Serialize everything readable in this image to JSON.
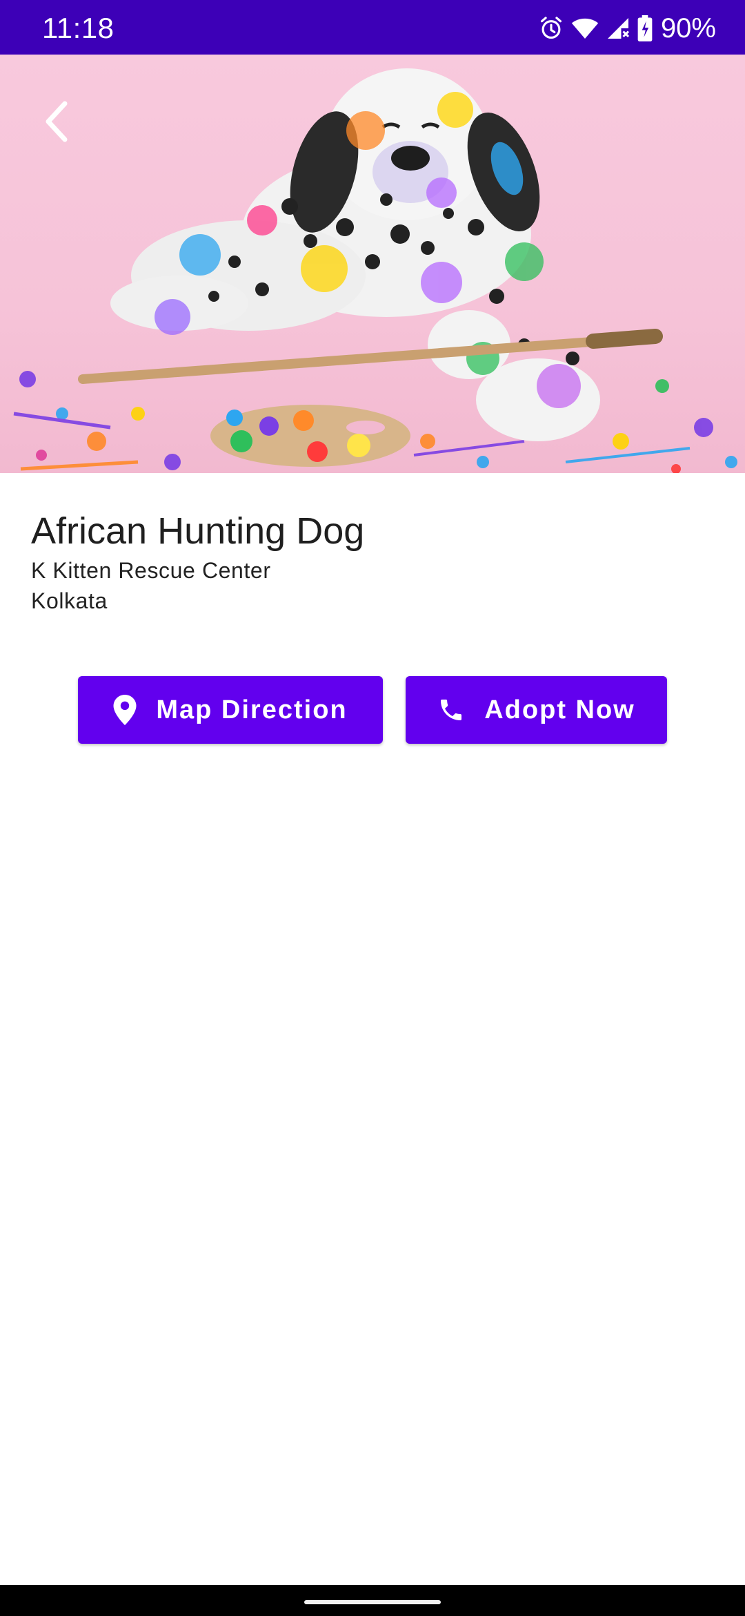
{
  "status_bar": {
    "time": "11:18",
    "battery_percent": "90%",
    "icons": [
      "alarm-icon",
      "wifi-icon",
      "cellular-signal-icon",
      "battery-charging-icon"
    ],
    "background_color": "#3d00b7"
  },
  "hero": {
    "image_subject": "dalmatian puppy covered in colorful paint with palette and brush",
    "back_icon": "chevron-left-icon"
  },
  "pet": {
    "name": "African Hunting Dog",
    "shelter": "K Kitten Rescue Center",
    "city": "Kolkata"
  },
  "actions": {
    "map_direction": {
      "label": "Map Direction",
      "icon": "location-pin-icon"
    },
    "adopt_now": {
      "label": "Adopt Now",
      "icon": "phone-icon"
    },
    "button_color": "#6200ee"
  }
}
